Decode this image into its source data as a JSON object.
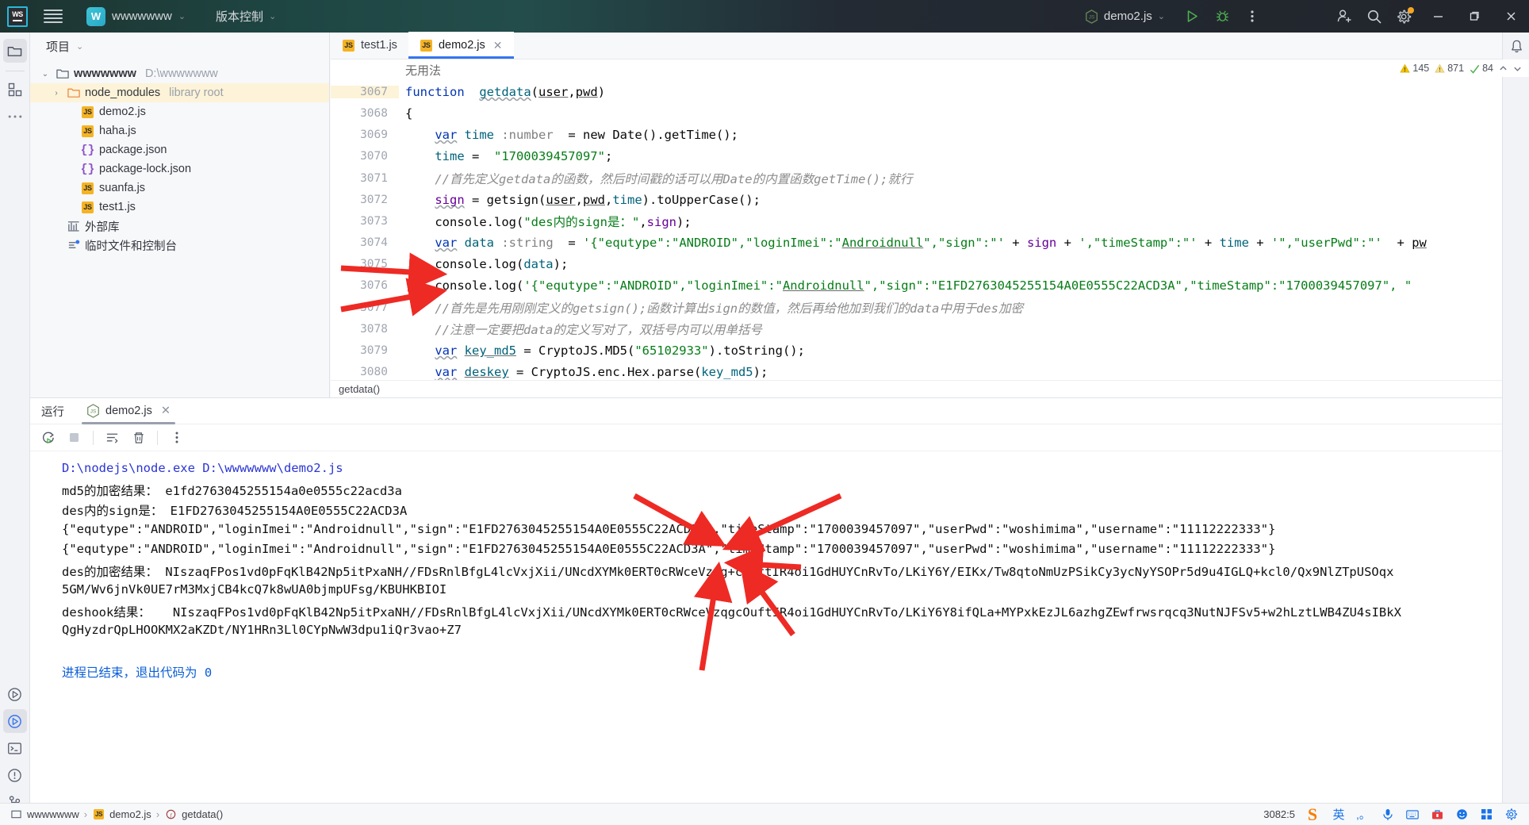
{
  "titlebar": {
    "logo": "WS",
    "project_name": "wwwwwww",
    "vcs_label": "版本控制",
    "run_config": "demo2.js",
    "icons": {
      "menu": "hamburger-icon",
      "run": "run-icon",
      "debug": "debug-icon",
      "more": "more-vertical-icon",
      "share": "add-user-icon",
      "search": "search-icon",
      "settings": "settings-gear-icon",
      "minimize": "minimize-icon",
      "maximize": "maximize-icon",
      "close": "close-icon"
    }
  },
  "project": {
    "header": "项目",
    "tree": [
      {
        "label": "wwwwwww",
        "detail": "D:\\wwwwwww",
        "type": "folder",
        "indent": 0,
        "expanded": true,
        "bold": true,
        "highlight": false
      },
      {
        "label": "node_modules",
        "detail": "library root",
        "type": "folder-orange",
        "indent": 1,
        "expanded": false,
        "bold": false,
        "highlight": true
      },
      {
        "label": "demo2.js",
        "detail": "",
        "type": "js",
        "indent": 2,
        "bold": false,
        "highlight": false
      },
      {
        "label": "haha.js",
        "detail": "",
        "type": "js",
        "indent": 2,
        "bold": false,
        "highlight": false
      },
      {
        "label": "package.json",
        "detail": "",
        "type": "json",
        "indent": 2,
        "bold": false,
        "highlight": false
      },
      {
        "label": "package-lock.json",
        "detail": "",
        "type": "json",
        "indent": 2,
        "bold": false,
        "highlight": false
      },
      {
        "label": "suanfa.js",
        "detail": "",
        "type": "js",
        "indent": 2,
        "bold": false,
        "highlight": false
      },
      {
        "label": "test1.js",
        "detail": "",
        "type": "js",
        "indent": 2,
        "bold": false,
        "highlight": false
      },
      {
        "label": "外部库",
        "detail": "",
        "type": "lib",
        "indent": 1,
        "bold": false,
        "highlight": false
      },
      {
        "label": "临时文件和控制台",
        "detail": "",
        "type": "scratch",
        "indent": 1,
        "bold": false,
        "highlight": false
      }
    ]
  },
  "editor": {
    "tabs": [
      {
        "label": "test1.js",
        "active": false,
        "closable": false
      },
      {
        "label": "demo2.js",
        "active": true,
        "closable": true
      }
    ],
    "fold_hint": "无用法",
    "inspections": {
      "warnings": "145",
      "weak_warnings": "871",
      "typos": "84"
    },
    "breadcrumb": "getdata()",
    "lines": [
      {
        "no": "3067",
        "tokens": [
          {
            "t": "function ",
            "c": "kw"
          },
          {
            "t": " ",
            "c": "plain"
          },
          {
            "t": "getdata",
            "c": "fn wavy"
          },
          {
            "t": "(",
            "c": "plain"
          },
          {
            "t": "user",
            "c": "plain undl"
          },
          {
            "t": ",",
            "c": "plain"
          },
          {
            "t": "pwd",
            "c": "plain undl"
          },
          {
            "t": ")",
            "c": "plain"
          }
        ]
      },
      {
        "no": "3068",
        "tokens": [
          {
            "t": "{",
            "c": "plain"
          }
        ]
      },
      {
        "no": "3069",
        "tokens": [
          {
            "t": "    ",
            "c": "plain"
          },
          {
            "t": "var",
            "c": "kw wavy"
          },
          {
            "t": " ",
            "c": "plain"
          },
          {
            "t": "time",
            "c": "fn"
          },
          {
            "t": " :",
            "c": "typ"
          },
          {
            "t": "number",
            "c": "typ"
          },
          {
            "t": "  = ",
            "c": "plain"
          },
          {
            "t": "new",
            "c": "plain"
          },
          {
            "t": " Date().getTime();",
            "c": "plain"
          }
        ]
      },
      {
        "no": "3070",
        "tokens": [
          {
            "t": "    ",
            "c": "plain"
          },
          {
            "t": "time",
            "c": "fn"
          },
          {
            "t": " =  ",
            "c": "plain"
          },
          {
            "t": "\"1700039457097\"",
            "c": "str"
          },
          {
            "t": ";",
            "c": "plain"
          }
        ]
      },
      {
        "no": "3071",
        "tokens": [
          {
            "t": "    //首先定义getdata的函数，然后时间戳的话可以用Date的内置函数getTime();就行",
            "c": "cmt"
          }
        ]
      },
      {
        "no": "3072",
        "tokens": [
          {
            "t": "    ",
            "c": "plain"
          },
          {
            "t": "sign",
            "c": "pm wavy"
          },
          {
            "t": " = getsign(",
            "c": "plain"
          },
          {
            "t": "user",
            "c": "plain undl"
          },
          {
            "t": ",",
            "c": "plain"
          },
          {
            "t": "pwd",
            "c": "plain undl"
          },
          {
            "t": ",",
            "c": "plain"
          },
          {
            "t": "time",
            "c": "fn"
          },
          {
            "t": ").toUpperCase();",
            "c": "plain"
          }
        ]
      },
      {
        "no": "3073",
        "tokens": [
          {
            "t": "    console.log(",
            "c": "plain"
          },
          {
            "t": "\"des内的sign是：\"",
            "c": "str"
          },
          {
            "t": ",",
            "c": "plain"
          },
          {
            "t": "sign",
            "c": "pm"
          },
          {
            "t": ");",
            "c": "plain"
          }
        ]
      },
      {
        "no": "3074",
        "tokens": [
          {
            "t": "    ",
            "c": "plain"
          },
          {
            "t": "var",
            "c": "kw wavy"
          },
          {
            "t": " ",
            "c": "plain"
          },
          {
            "t": "data",
            "c": "fn"
          },
          {
            "t": " :",
            "c": "typ"
          },
          {
            "t": "string",
            "c": "typ"
          },
          {
            "t": "  = ",
            "c": "plain"
          },
          {
            "t": "'{\"equtype\":\"ANDROID\",\"loginImei\":\"",
            "c": "str"
          },
          {
            "t": "Androidnull",
            "c": "str undl"
          },
          {
            "t": "\",\"sign\":\"'",
            "c": "str"
          },
          {
            "t": " + ",
            "c": "plain"
          },
          {
            "t": "sign",
            "c": "pm"
          },
          {
            "t": " + ",
            "c": "plain"
          },
          {
            "t": "',\"timeStamp\":\"'",
            "c": "str"
          },
          {
            "t": " + ",
            "c": "plain"
          },
          {
            "t": "time",
            "c": "fn"
          },
          {
            "t": " + ",
            "c": "plain"
          },
          {
            "t": "'\",\"userPwd\":\"'",
            "c": "str"
          },
          {
            "t": "  + ",
            "c": "plain"
          },
          {
            "t": "pw",
            "c": "plain undl"
          }
        ]
      },
      {
        "no": "3075",
        "tokens": [
          {
            "t": "    console.log(",
            "c": "plain"
          },
          {
            "t": "data",
            "c": "fn"
          },
          {
            "t": ");",
            "c": "plain"
          }
        ]
      },
      {
        "no": "3076",
        "tokens": [
          {
            "t": "    console.log(",
            "c": "plain"
          },
          {
            "t": "'{\"equtype\":\"ANDROID\",\"loginImei\":\"",
            "c": "str"
          },
          {
            "t": "Androidnull",
            "c": "str undl"
          },
          {
            "t": "\",\"sign\":\"E1FD2763045255154A0E0555C22ACD3A\",\"timeStamp\":\"1700039457097\", ",
            "c": "str"
          },
          {
            "t": "\"",
            "c": "str"
          }
        ]
      },
      {
        "no": "3077",
        "tokens": [
          {
            "t": "    //首先是先用刚刚定义的getsign();函数计算出sign的数值，然后再给他加到我们的data中用于des加密",
            "c": "cmt"
          }
        ]
      },
      {
        "no": "3078",
        "tokens": [
          {
            "t": "    //注意一定要把data的定义写对了，双括号内可以用单括号",
            "c": "cmt"
          }
        ]
      },
      {
        "no": "3079",
        "tokens": [
          {
            "t": "    ",
            "c": "plain"
          },
          {
            "t": "var",
            "c": "kw wavy"
          },
          {
            "t": " ",
            "c": "plain"
          },
          {
            "t": "key_md5",
            "c": "fn undl"
          },
          {
            "t": " = CryptoJS.MD5(",
            "c": "plain"
          },
          {
            "t": "\"65102933\"",
            "c": "str"
          },
          {
            "t": ").toString();",
            "c": "plain"
          }
        ]
      },
      {
        "no": "3080",
        "tokens": [
          {
            "t": "    ",
            "c": "plain"
          },
          {
            "t": "var",
            "c": "kw wavy"
          },
          {
            "t": " ",
            "c": "plain"
          },
          {
            "t": "deskey",
            "c": "fn undl"
          },
          {
            "t": " = CryptoJS.enc.Hex.parse(",
            "c": "plain"
          },
          {
            "t": "key_md5",
            "c": "fn"
          },
          {
            "t": ");",
            "c": "plain"
          }
        ]
      }
    ]
  },
  "run": {
    "tabs": [
      {
        "label": "运行",
        "active": false,
        "icon": "",
        "closable": false
      },
      {
        "label": "demo2.js",
        "active": true,
        "icon": "nodejs-icon",
        "closable": true
      }
    ],
    "toolbar": [
      {
        "name": "rerun-button",
        "icon": "rerun-icon"
      },
      {
        "name": "stop-button",
        "icon": "stop-icon"
      },
      {
        "name": "soft-wrap-button",
        "icon": "wrap-lines-icon"
      },
      {
        "name": "clear-all-button",
        "icon": "trash-icon"
      },
      {
        "name": "more-options-button",
        "icon": "more-vertical-icon"
      }
    ],
    "console_lines": [
      {
        "text": "D:\\nodejs\\node.exe D:\\wwwwwww\\demo2.js",
        "style": "c-cmd"
      },
      {
        "text": "md5的加密结果： e1fd2763045255154a0e0555c22acd3a",
        "style": "c-txt"
      },
      {
        "text": "des内的sign是： E1FD2763045255154A0E0555C22ACD3A",
        "style": "c-txt"
      },
      {
        "text": "{\"equtype\":\"ANDROID\",\"loginImei\":\"Androidnull\",\"sign\":\"E1FD2763045255154A0E0555C22ACD3A\",\"timeStamp\":\"1700039457097\",\"userPwd\":\"woshimima\",\"username\":\"11112222333\"}",
        "style": "c-txt"
      },
      {
        "text": "{\"equtype\":\"ANDROID\",\"loginImei\":\"Androidnull\",\"sign\":\"E1FD2763045255154A0E0555C22ACD3A\",\"timeStamp\":\"1700039457097\",\"userPwd\":\"woshimima\",\"username\":\"11112222333\"}",
        "style": "c-txt"
      },
      {
        "text": "des的加密结果： NIszaqFPos1vd0pFqKlB42Np5itPxaNH//FDsRnlBfgL4lcVxjXii/UNcdXYMk0ERT0cRWceVzqg+cOuftIR4oi1GdHUYCnRvTo/LKiY6Y/EIKx/Tw8qtoNmUzPSikCy3ycNyYSOPr5d9u4IGLQ+kcl0/Qx9NlZTpUSOqx",
        "style": "c-txt"
      },
      {
        "text": "5GM/Wv6jnVk0UE7rM3MxjCB4kcQ7k8wUA0bjmpUFsg/KBUHKBIOI",
        "style": "c-txt"
      },
      {
        "text": "deshook结果：   NIszaqFPos1vd0pFqKlB42Np5itPxaNH//FDsRnlBfgL4lcVxjXii/UNcdXYMk0ERT0cRWceVzqgcOuftIR4oi1GdHUYCnRvTo/LKiY6Y8ifQLa+MYPxkEzJL6azhgZEwfrwsrqcq3NutNJFSv5+w2hLztLWB4ZU4sIBkX",
        "style": "c-txt"
      },
      {
        "text": "QgHyzdrQpLHOOKMX2aKZDt/NY1HRn3Ll0CYpNwW3dpu1iQr3vao+Z7",
        "style": "c-txt"
      },
      {
        "text": "",
        "style": "c-txt"
      },
      {
        "text": "进程已结束，退出代码为 0",
        "style": "c-done"
      }
    ]
  },
  "statusbar": {
    "breadcrumbs": [
      {
        "label": "wwwwwww",
        "icon": "folder-icon"
      },
      {
        "label": "demo2.js",
        "icon": "js-icon"
      },
      {
        "label": "getdata()",
        "icon": "function-icon"
      }
    ],
    "caret_position": "3082:5",
    "ime": {
      "brand": "S",
      "mode": "英"
    }
  },
  "colors": {
    "accent_blue": "#3574f0",
    "string_green": "#067d17",
    "keyword_blue": "#0033b3",
    "highlight_yellow": "#fdf3d8",
    "arrow_red": "#ee2a24",
    "titlebar_teal": "#1e4542"
  }
}
